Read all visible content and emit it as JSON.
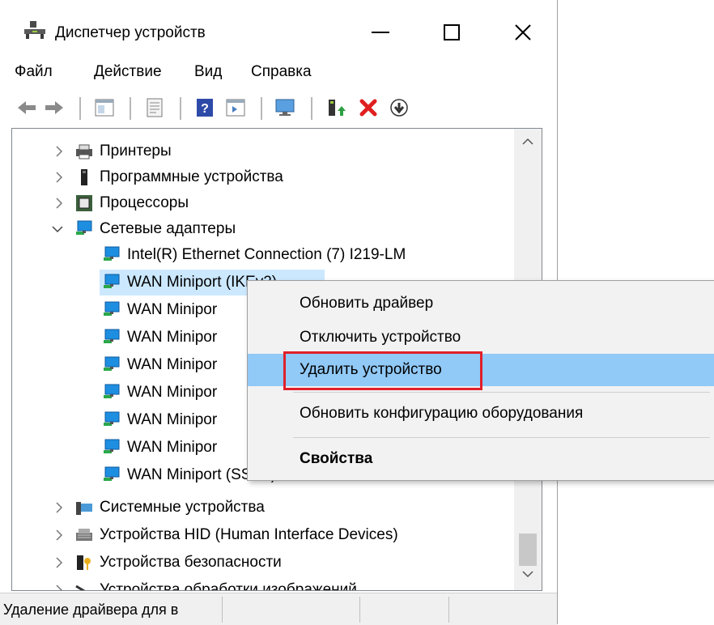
{
  "window": {
    "title": "Диспетчер устройств",
    "minimize_glyph": "—",
    "maximize_glyph": "☐",
    "close_glyph": "✕"
  },
  "menu": [
    "Файл",
    "Действие",
    "Вид",
    "Справка"
  ],
  "toolbar": {
    "icons": [
      "back-icon",
      "forward-icon",
      "properties-pane-icon",
      "properties-icon",
      "help-icon",
      "show-hidden-icon",
      "monitor-icon",
      "update-driver-icon",
      "uninstall-icon",
      "enable-device-icon"
    ]
  },
  "tree": {
    "items": [
      {
        "label": "Принтеры",
        "expanded": false,
        "icon": "printer-icon"
      },
      {
        "label": "Программные устройства",
        "expanded": false,
        "icon": "software-device-icon"
      },
      {
        "label": "Процессоры",
        "expanded": false,
        "icon": "processor-icon"
      },
      {
        "label": "Сетевые адаптеры",
        "expanded": true,
        "icon": "network-adapter-icon"
      }
    ],
    "children": [
      "Intel(R) Ethernet Connection (7) I219-LM",
      "WAN Miniport (IKEv2)",
      "WAN Minipor",
      "WAN Minipor",
      "WAN Minipor",
      "WAN Minipor",
      "WAN Minipor",
      "WAN Minipor",
      "WAN Miniport (SSTP)"
    ],
    "after": [
      {
        "label": "Системные устройства",
        "icon": "system-device-icon"
      },
      {
        "label": "Устройства HID (Human Interface Devices)",
        "icon": "hid-icon"
      },
      {
        "label": "Устройства безопасности",
        "icon": "security-device-icon"
      },
      {
        "label": "Устройства обработки изображений",
        "icon": "imaging-device-icon"
      }
    ]
  },
  "context_menu": {
    "items": [
      "Обновить драйвер",
      "Отключить устройство",
      "Удалить устройство",
      "Обновить конфигурацию оборудования",
      "Свойства"
    ],
    "highlighted": "Удалить устройство",
    "highlight_color": "#91c9f7",
    "annotation_color": "#e0202a"
  },
  "status": {
    "text": "Удаление драйвера для в"
  },
  "colors": {
    "selection": "#cce8ff",
    "network_icon": "#1e8ee0"
  }
}
